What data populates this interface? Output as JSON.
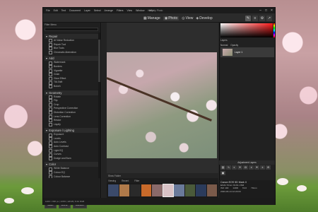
{
  "app": {
    "title": "Affinity Photo",
    "menu": [
      "File",
      "Edit",
      "Text",
      "Document",
      "Layer",
      "Select",
      "Arrange",
      "Filters",
      "View",
      "Window",
      "Help"
    ],
    "modes": [
      {
        "label": "Manage",
        "icon": "grid-icon"
      },
      {
        "label": "Photo",
        "icon": "camera-icon",
        "active": true
      },
      {
        "label": "View",
        "icon": "eye-icon"
      },
      {
        "label": "Develop",
        "icon": "develop-icon"
      }
    ]
  },
  "left_panel": {
    "title": "Filter Menu",
    "sections": [
      {
        "name": "Repair",
        "items": [
          "AI Noise Reduction",
          "Repair Tool",
          "Blur Tools",
          "Chromatic Aberration"
        ]
      },
      {
        "name": "Add",
        "items": [
          "Watermark",
          "Borders",
          "Vignette",
          "Grain",
          "Glow Effect",
          "Tilt-Shift",
          "Bokeh"
        ]
      },
      {
        "name": "Geometry",
        "items": [
          "Rotate",
          "Flip",
          "Crop",
          "Perspective Correction",
          "Distortion Correction",
          "Lens Correction",
          "Resize",
          "Liquify"
        ]
      },
      {
        "name": "Exposure / Lighting",
        "items": [
          "Exposure",
          "Levels",
          "Auto Levels",
          "Auto Contrast",
          "Light EQ",
          "Curves",
          "Dodge and Burn"
        ]
      },
      {
        "name": "Color",
        "items": [
          "White Balance",
          "Colour EQ",
          "Colour Balance",
          "Convert to Black & White",
          "Split Tone",
          "Color Grade"
        ]
      }
    ],
    "buttons": {
      "save": "Save",
      "done": "Done",
      "cancel": "Cancel"
    }
  },
  "right_panel": {
    "layers_label": "Layers",
    "blend_mode": "Normal",
    "opacity_label": "Opacity",
    "layer_name": "Layer 1",
    "adjustment_label": "Adjustment Layers",
    "info": {
      "title": "Canon EOS 5D Mark II",
      "lens": "EF24-70mm f/2.8L USM",
      "iso": "ISO 100",
      "shutter": "1/200",
      "aperture": "f/4.0",
      "focal": "70mm",
      "date": "2023-03-14 12:24:03"
    }
  },
  "filmstrip": {
    "tabs": [
      "Viewing",
      "Recent",
      "Filter"
    ],
    "count_label": "Show Folder",
    "thumb_count": 10
  },
  "statusbar": {
    "text": "1200 × 800 px  |  100%  |  sRGB  |  8-bit RGB"
  },
  "colors": {
    "accent": "#ff1a1a",
    "window_bg": "#262626",
    "panel_bg": "#1f1f1f"
  }
}
